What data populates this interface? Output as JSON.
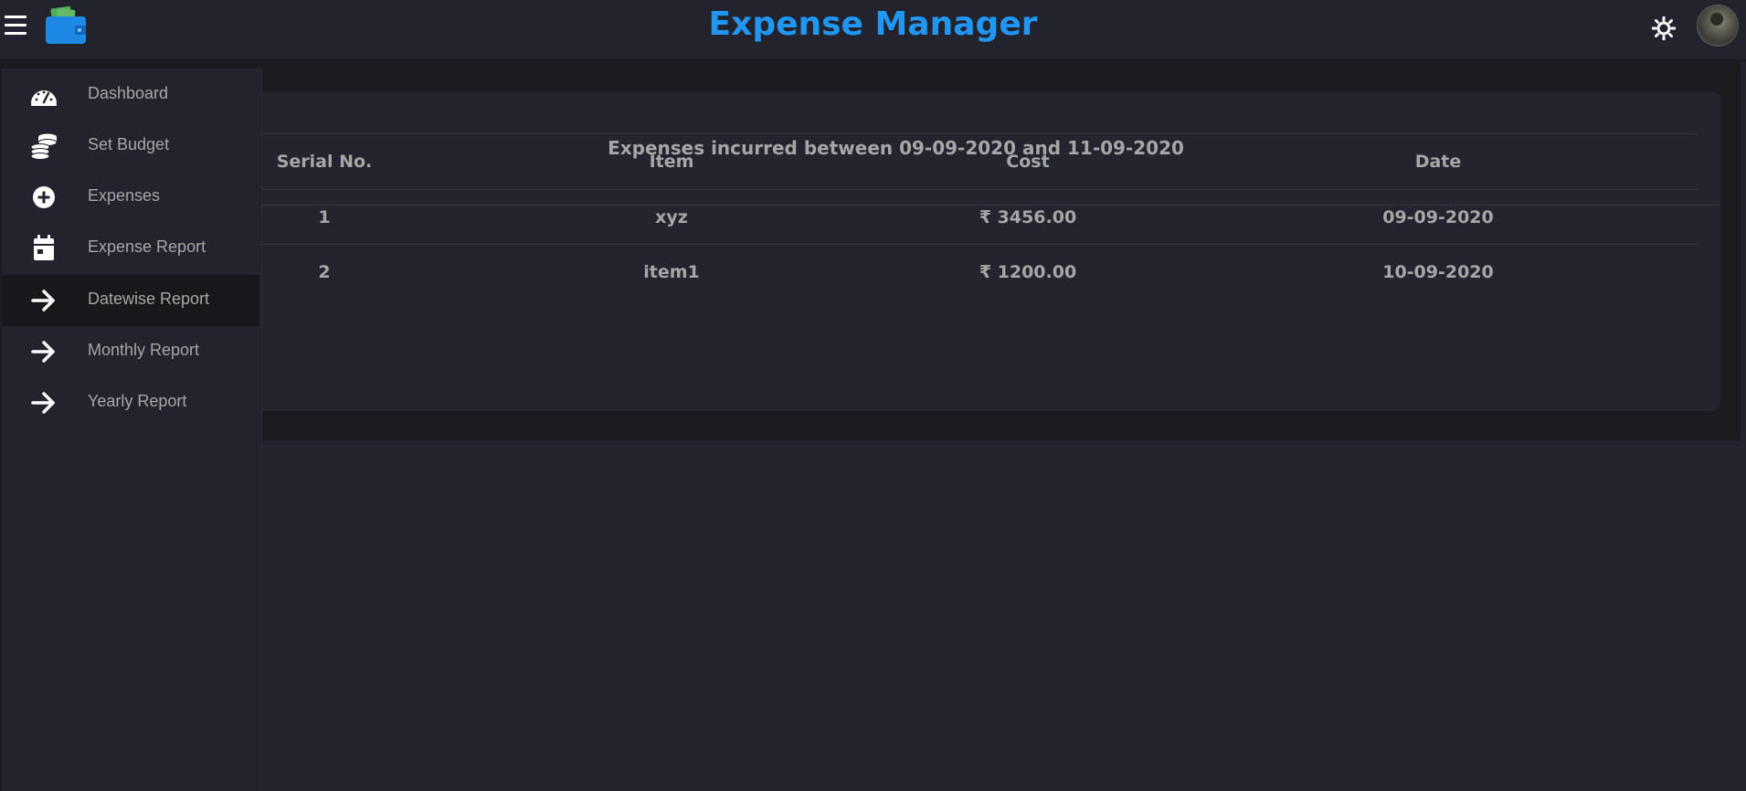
{
  "header": {
    "title": "Expense Manager",
    "menu_icon": "hamburger-menu-icon",
    "logo_icon": "wallet-icon",
    "theme_icon": "sun-icon",
    "avatar": "user-avatar"
  },
  "sidebar": {
    "items": [
      {
        "label": "Dashboard",
        "icon": "speedometer-icon",
        "active": false
      },
      {
        "label": "Set Budget",
        "icon": "coins-icon",
        "active": false
      },
      {
        "label": "Expenses",
        "icon": "plus-circle-icon",
        "active": false
      },
      {
        "label": "Expense Report",
        "icon": "calendar-icon",
        "active": false
      },
      {
        "label": "Datewise Report",
        "icon": "arrow-right-icon",
        "active": true
      },
      {
        "label": "Monthly Report",
        "icon": "arrow-right-icon",
        "active": false
      },
      {
        "label": "Yearly Report",
        "icon": "arrow-right-icon",
        "active": false
      }
    ]
  },
  "report": {
    "title": "Expenses incurred between 09-09-2020 and 11-09-2020",
    "columns": [
      "Serial No.",
      "Item",
      "Cost",
      "Date"
    ],
    "rows": [
      [
        "1",
        "xyz",
        "₹ 3456.00",
        "09-09-2020"
      ],
      [
        "2",
        "item1",
        "₹ 1200.00",
        "10-09-2020"
      ]
    ]
  },
  "colors": {
    "accent": "#2196f3",
    "background": "#23232e",
    "text": "#a6a6a6"
  }
}
